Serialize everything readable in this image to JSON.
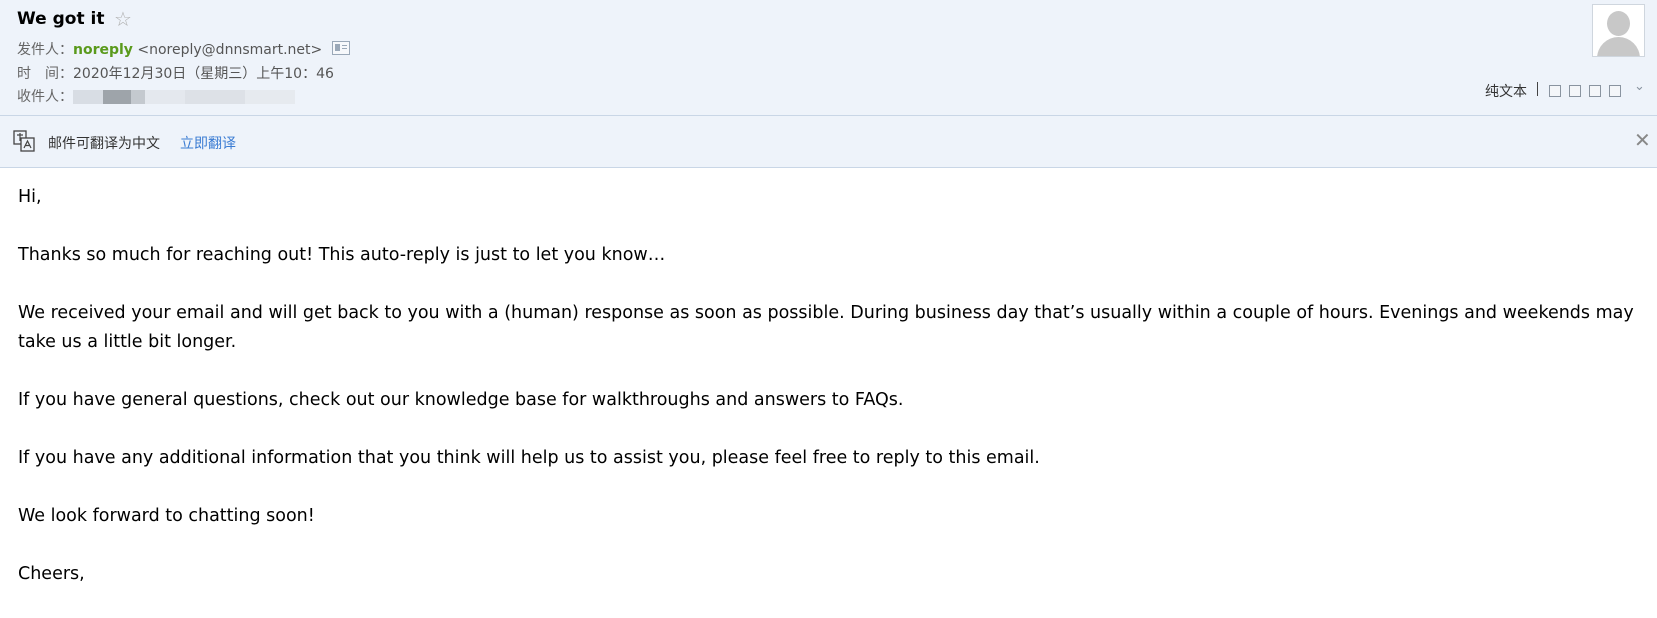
{
  "email": {
    "subject": "We got it",
    "star_icon": "☆",
    "sender_label": "发件人：",
    "sender_name": "noreply",
    "sender_address": "<noreply@dnnsmart.net>",
    "time_label": "时　间：",
    "time_value": "2020年12月30日（星期三）上午10：46",
    "recipient_label": "收件人："
  },
  "toolbar": {
    "plain_text_label": "纯文本",
    "expand_icon": "⌄"
  },
  "translate_bar": {
    "message": "邮件可翻译为中文",
    "action_label": "立即翻译",
    "close_icon": "✕"
  },
  "body": {
    "paragraphs": [
      "Hi,",
      "Thanks so much for reaching out! This auto-reply is just to let you know…",
      "We received your email and will get back to you with a (human) response as soon as possible. During business day that’s usually within a couple of hours. Evenings and weekends may take us a little bit longer.",
      "If you have general questions, check out our knowledge base for walkthroughs and answers to FAQs.",
      "If you have any additional information that you think will help us to assist you, please feel free to reply to this email.",
      "We look forward to chatting soon!",
      "Cheers,"
    ]
  },
  "icons": {
    "avatar": "avatar-placeholder-icon",
    "contact_card": "contact-card-icon",
    "translate": "translate-icon",
    "toolbar_icons": [
      "new-window-icon",
      "notes-icon",
      "download-icon",
      "print-icon"
    ]
  },
  "colors": {
    "header_bg": "#eef3fa",
    "sender_name": "#5a9a1c",
    "link": "#3b7cd3"
  }
}
